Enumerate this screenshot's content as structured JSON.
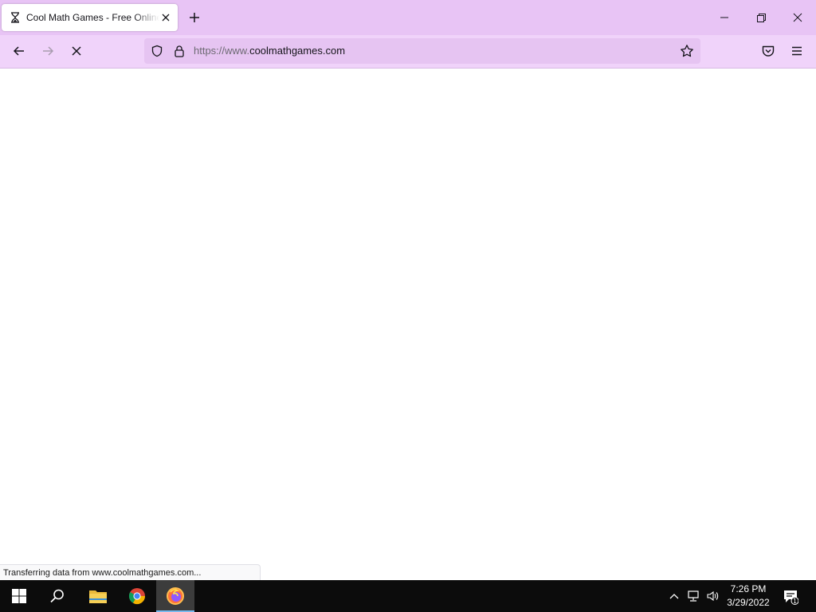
{
  "browser": {
    "tab": {
      "title": "Cool Math Games - Free Online",
      "favicon": "hourglass-loading-icon",
      "close_icon": "close-icon"
    },
    "new_tab_icon": "plus-icon",
    "window_controls": [
      "minimize-icon",
      "restore-icon",
      "close-icon"
    ],
    "nav": {
      "back_icon": "arrow-left-icon",
      "forward_icon": "arrow-right-icon",
      "stop_icon": "stop-loading-icon",
      "pocket_icon": "pocket-icon",
      "menu_icon": "hamburger-menu-icon"
    },
    "urlbar": {
      "url_prefix": "https://www.",
      "url_domain": "coolmathgames.com",
      "shield_icon": "tracking-protection-shield-icon",
      "lock_icon": "lock-icon",
      "bookmark_icon": "star-icon"
    },
    "status_text": "Transferring data from www.coolmathgames.com..."
  },
  "taskbar": {
    "items": [
      "windows-start-icon",
      "search-icon",
      "file-explorer-icon",
      "chrome-icon",
      "firefox-icon"
    ],
    "active_item": "firefox-icon",
    "tray_icons": [
      "chevron-up-icon",
      "network-icon",
      "volume-icon"
    ],
    "time": "7:26 PM",
    "date": "3/29/2022",
    "notification_count": "1"
  },
  "colors": {
    "titlebar": "#e8c4f5",
    "navbar": "#f0d3fa",
    "urlbar": "#e6c4f2",
    "taskbar": "#0c0c0c",
    "taskbar_accent": "#76b9ed"
  }
}
